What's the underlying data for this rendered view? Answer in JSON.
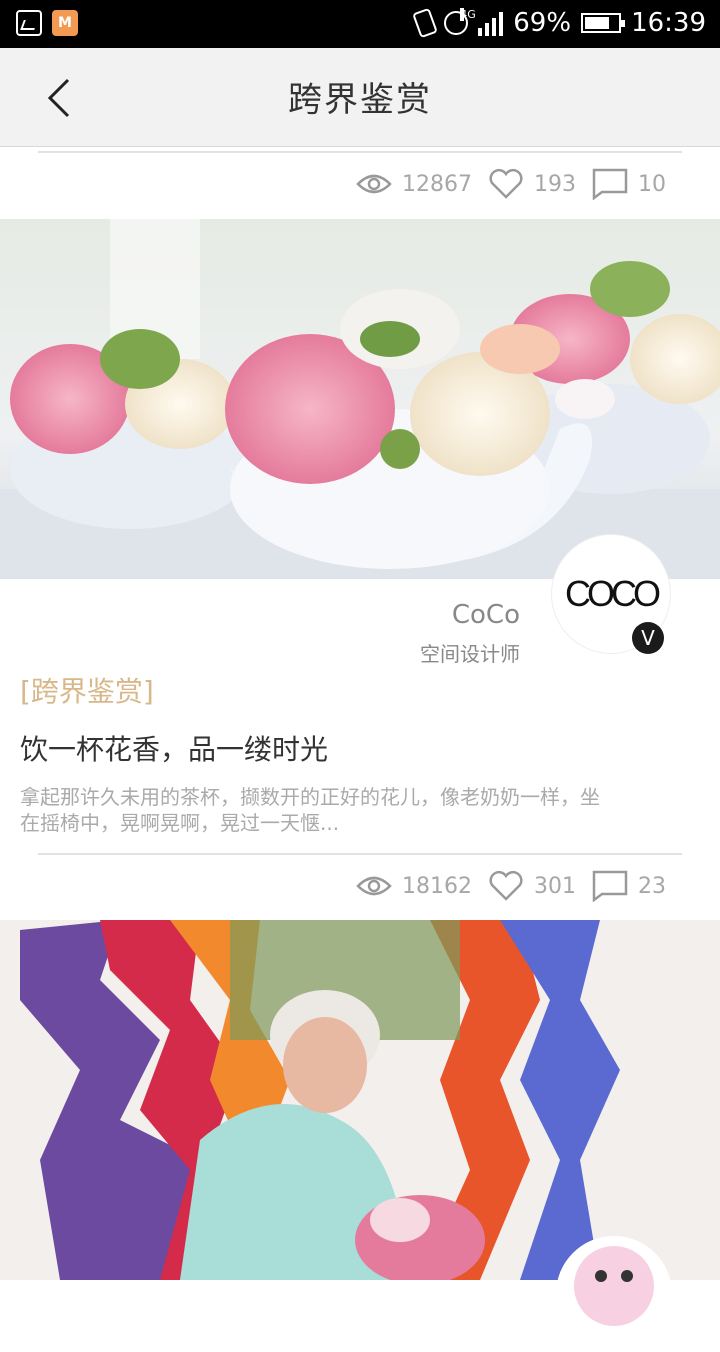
{
  "status_bar": {
    "network": "4G",
    "battery": "69%",
    "time": "16:39"
  },
  "header": {
    "title": "跨界鉴赏"
  },
  "post_prev": {
    "views": "12867",
    "likes": "193",
    "comments": "10"
  },
  "post": {
    "author_name": "CoCo",
    "author_role": "空间设计师",
    "avatar_text": "COCO",
    "verified_badge": "V",
    "category": "[跨界鉴赏]",
    "title": "饮一杯花香，品一缕时光",
    "summary": "拿起那许久未用的茶杯，撷数开的正好的花儿，像老奶奶一样，坐在摇椅中，晃啊晃啊，晃过一天惬...",
    "views": "18162",
    "likes": "301",
    "comments": "23"
  },
  "colors": {
    "accent": "#d8b88a",
    "stat_gray": "#a7a7a7"
  }
}
